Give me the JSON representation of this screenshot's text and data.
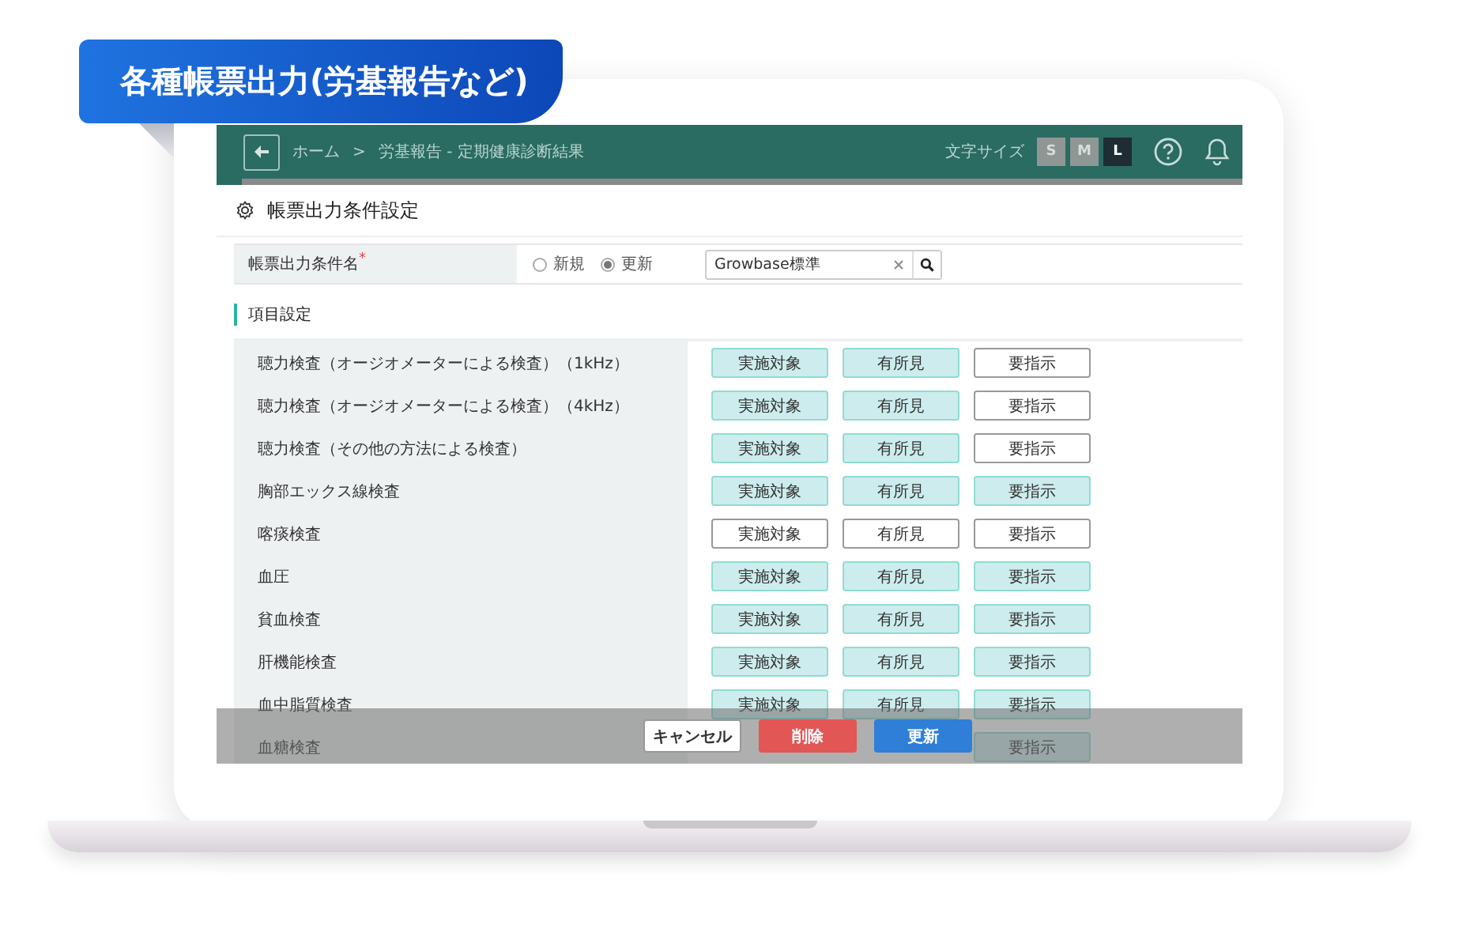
{
  "banner": {
    "title": "各種帳票出力(労基報告など)"
  },
  "header": {
    "breadcrumb": [
      "ホーム",
      "労基報告 - 定期健康診断結果"
    ],
    "separator": ">",
    "font_size_label": "文字サイズ",
    "font_sizes": [
      {
        "label": "S",
        "selected": false
      },
      {
        "label": "M",
        "selected": false
      },
      {
        "label": "L",
        "selected": true
      }
    ]
  },
  "page_title": "帳票出力条件設定",
  "form": {
    "label": "帳票出力条件名",
    "required_mark": "*",
    "radios": [
      {
        "label": "新規",
        "selected": false
      },
      {
        "label": "更新",
        "selected": true
      }
    ],
    "search": {
      "value": "Growbase標準"
    }
  },
  "section_title": "項目設定",
  "items": [
    {
      "name": "聴力検査（オージオメーターによる検査）（1kHz）",
      "options": [
        {
          "label": "実施対象",
          "selected": true
        },
        {
          "label": "有所見",
          "selected": true
        },
        {
          "label": "要指示",
          "selected": false
        }
      ]
    },
    {
      "name": "聴力検査（オージオメーターによる検査）（4kHz）",
      "options": [
        {
          "label": "実施対象",
          "selected": true
        },
        {
          "label": "有所見",
          "selected": true
        },
        {
          "label": "要指示",
          "selected": false
        }
      ]
    },
    {
      "name": "聴力検査（その他の方法による検査）",
      "options": [
        {
          "label": "実施対象",
          "selected": true
        },
        {
          "label": "有所見",
          "selected": true
        },
        {
          "label": "要指示",
          "selected": false
        }
      ]
    },
    {
      "name": "胸部エックス線検査",
      "options": [
        {
          "label": "実施対象",
          "selected": true
        },
        {
          "label": "有所見",
          "selected": true
        },
        {
          "label": "要指示",
          "selected": true
        }
      ]
    },
    {
      "name": "喀痰検査",
      "options": [
        {
          "label": "実施対象",
          "selected": false
        },
        {
          "label": "有所見",
          "selected": false
        },
        {
          "label": "要指示",
          "selected": false
        }
      ]
    },
    {
      "name": "血圧",
      "options": [
        {
          "label": "実施対象",
          "selected": true
        },
        {
          "label": "有所見",
          "selected": true
        },
        {
          "label": "要指示",
          "selected": true
        }
      ]
    },
    {
      "name": "貧血検査",
      "options": [
        {
          "label": "実施対象",
          "selected": true
        },
        {
          "label": "有所見",
          "selected": true
        },
        {
          "label": "要指示",
          "selected": true
        }
      ]
    },
    {
      "name": "肝機能検査",
      "options": [
        {
          "label": "実施対象",
          "selected": true
        },
        {
          "label": "有所見",
          "selected": true
        },
        {
          "label": "要指示",
          "selected": true
        }
      ]
    },
    {
      "name": "血中脂質検査",
      "options": [
        {
          "label": "実施対象",
          "selected": true
        },
        {
          "label": "有所見",
          "selected": true
        },
        {
          "label": "要指示",
          "selected": true
        }
      ]
    },
    {
      "name": "血糖検査",
      "options": [
        {
          "label": "要指示",
          "selected": true
        }
      ]
    }
  ],
  "footer": {
    "buttons": [
      {
        "label": "キャンセル",
        "kind": "cancel"
      },
      {
        "label": "削除",
        "kind": "delete"
      },
      {
        "label": "更新",
        "kind": "update"
      }
    ]
  }
}
